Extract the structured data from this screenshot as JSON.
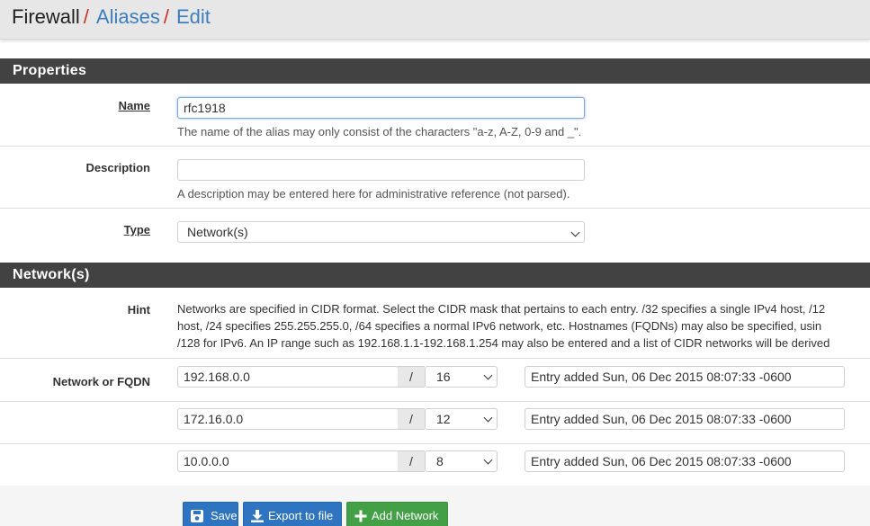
{
  "breadcrumb": {
    "home": "Firewall",
    "separator": "/",
    "aliases": "Aliases",
    "edit": "Edit"
  },
  "properties": {
    "heading": "Properties",
    "name": {
      "label": "Name",
      "value": "rfc1918",
      "help": "The name of the alias may only consist of the characters \"a-z, A-Z, 0-9 and _\"."
    },
    "description": {
      "label": "Description",
      "value": "",
      "help": "A description may be entered here for administrative reference (not parsed)."
    },
    "type": {
      "label": "Type",
      "selected": "Network(s)"
    }
  },
  "networks": {
    "heading": "Network(s)",
    "hint_label": "Hint",
    "hint_lines": [
      "Networks are specified in CIDR format. Select the CIDR mask that pertains to each entry. /32 specifies a single IPv4 host, /12",
      "host, /24 specifies 255.255.255.0, /64 specifies a normal IPv6 network, etc. Hostnames (FQDNs) may also be specified, usin",
      "/128 for IPv6. An IP range such as 192.168.1.1-192.168.1.254 may also be entered and a list of CIDR networks will be derived"
    ],
    "field_label": "Network or FQDN",
    "slash": "/",
    "rows": [
      {
        "address": "192.168.0.0",
        "mask": "16",
        "description": "Entry added Sun, 06 Dec 2015 08:07:33 -0600"
      },
      {
        "address": "172.16.0.0",
        "mask": "12",
        "description": "Entry added Sun, 06 Dec 2015 08:07:33 -0600"
      },
      {
        "address": "10.0.0.0",
        "mask": "8",
        "description": "Entry added Sun, 06 Dec 2015 08:07:33 -0600"
      }
    ]
  },
  "buttons": {
    "save": "Save",
    "export": "Export to file",
    "add_network": "Add Network"
  },
  "colors": {
    "panel_heading": "#424242",
    "link": "#3d7fbd",
    "separator": "#c9302c",
    "primary": "#2f74c0",
    "success": "#43a047"
  }
}
